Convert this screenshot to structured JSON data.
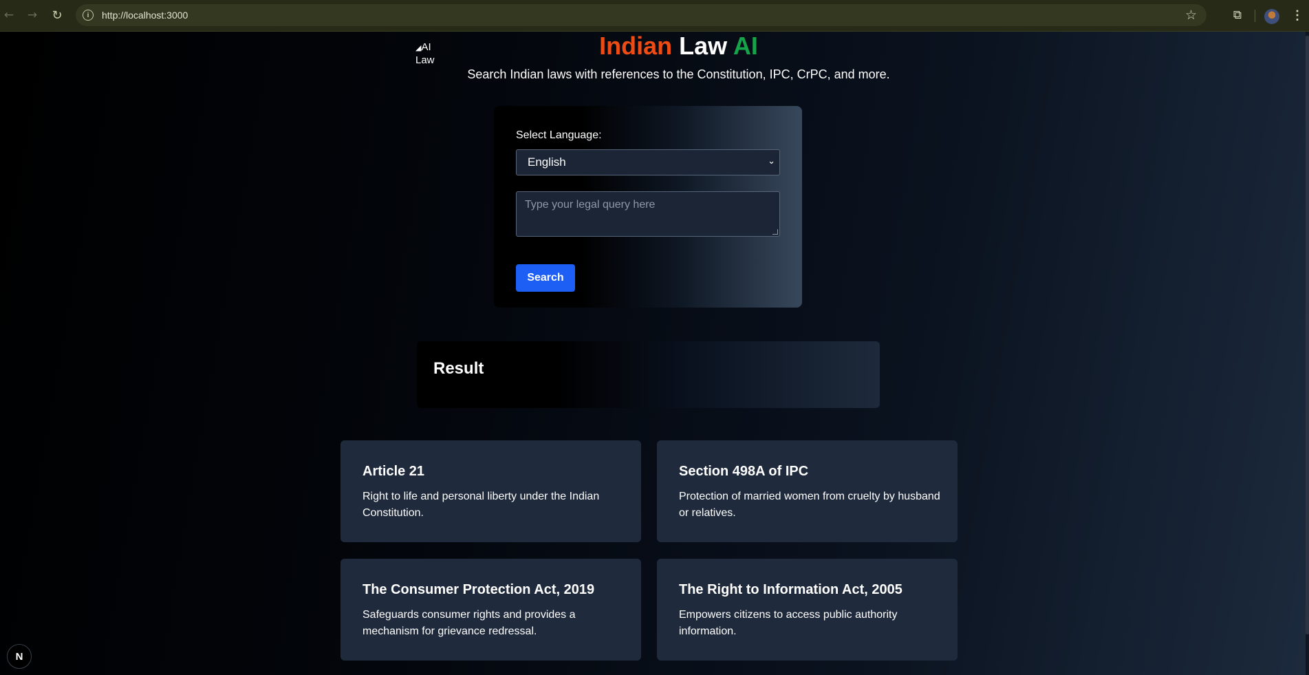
{
  "browser": {
    "url": "http://localhost:3000",
    "back_icon": "arrow-left-icon",
    "forward_icon": "arrow-right-icon",
    "reload_icon": "reload-icon",
    "info_icon": "info-icon",
    "star_icon": "star-icon",
    "extensions_icon": "puzzle-icon",
    "menu_icon": "kebab-menu-icon"
  },
  "header": {
    "logo_alt": "AI Law",
    "title_part1": "Indian",
    "title_part2": "Law",
    "title_part3": "AI",
    "subtitle": "Search Indian laws with references to the Constitution, IPC, CrPC, and more."
  },
  "search": {
    "language_label": "Select Language:",
    "language_selected": "English",
    "query_placeholder": "Type your legal query here",
    "button_label": "Search"
  },
  "result": {
    "heading": "Result"
  },
  "laws": [
    {
      "title": "Article 21",
      "description": "Right to life and personal liberty under the Indian Constitution."
    },
    {
      "title": "Section 498A of IPC",
      "description": "Protection of married women from cruelty by husband or relatives."
    },
    {
      "title": "The Consumer Protection Act, 2019",
      "description": "Safeguards consumer rights and provides a mechanism for grievance redressal."
    },
    {
      "title": "The Right to Information Act, 2005",
      "description": "Empowers citizens to access public authority information."
    }
  ],
  "dev_badge": {
    "label": "N"
  },
  "colors": {
    "title_indian": "#ef4b14",
    "title_law": "#ffffff",
    "title_ai": "#16a34a",
    "button": "#1d5ef5",
    "card": "#1f2a3c"
  }
}
